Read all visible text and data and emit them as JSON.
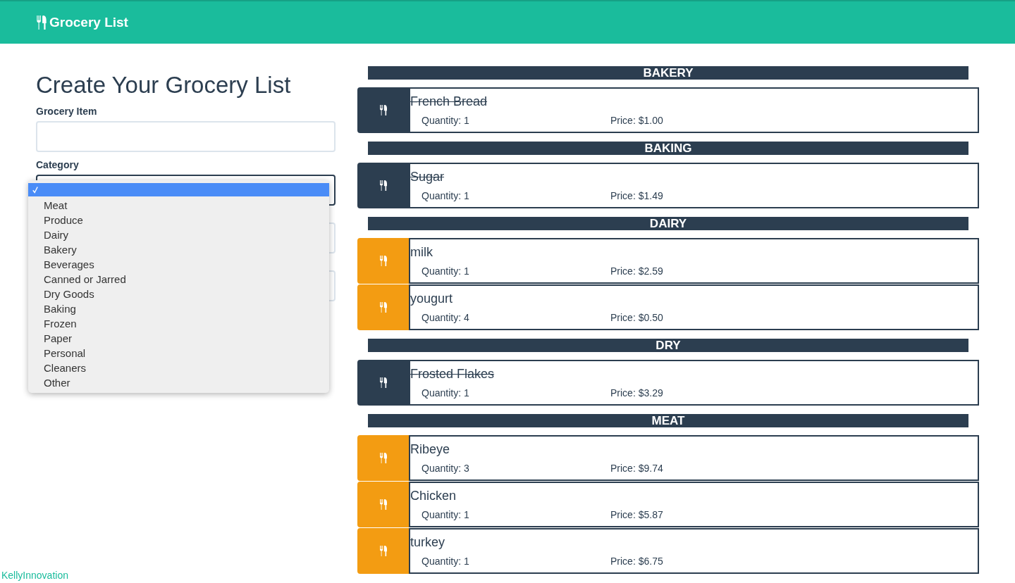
{
  "navbar": {
    "brand": "Grocery List"
  },
  "form": {
    "title": "Create Your Grocery List",
    "fields": [
      {
        "label": "Grocery Item",
        "kind": "text"
      },
      {
        "label": "Category",
        "kind": "select"
      },
      {
        "kind": "text"
      },
      {
        "kind": "text"
      }
    ],
    "dropdown": {
      "options": [
        {
          "selected": true
        },
        {
          "label": "Meat",
          "selected": false
        },
        {
          "label": "Produce",
          "selected": false
        },
        {
          "label": "Dairy",
          "selected": false
        },
        {
          "label": "Bakery",
          "selected": false
        },
        {
          "label": "Beverages",
          "selected": false
        },
        {
          "label": "Canned or Jarred",
          "selected": false
        },
        {
          "label": "Dry Goods",
          "selected": false
        },
        {
          "label": "Baking",
          "selected": false
        },
        {
          "label": "Frozen",
          "selected": false
        },
        {
          "label": "Paper",
          "selected": false
        },
        {
          "label": "Personal",
          "selected": false
        },
        {
          "label": "Cleaners",
          "selected": false
        },
        {
          "label": "Other",
          "selected": false
        }
      ]
    }
  },
  "groups": [
    {
      "category": "BAKERY",
      "items": [
        {
          "name": "French Bread",
          "quantity": "Quantity: 1",
          "price": "Price: $1.00",
          "checked": true
        }
      ]
    },
    {
      "category": "BAKING",
      "items": [
        {
          "name": "Sugar",
          "quantity": "Quantity: 1",
          "price": "Price: $1.49",
          "checked": true
        }
      ]
    },
    {
      "category": "DAIRY",
      "items": [
        {
          "name": "milk",
          "quantity": "Quantity: 1",
          "price": "Price: $2.59",
          "checked": false
        },
        {
          "name": "yougurt",
          "quantity": "Quantity: 4",
          "price": "Price: $0.50",
          "checked": false
        }
      ]
    },
    {
      "category": "DRY",
      "items": [
        {
          "name": "Frosted Flakes",
          "quantity": "Quantity: 1",
          "price": "Price: $3.29",
          "checked": true
        }
      ]
    },
    {
      "category": "MEAT",
      "items": [
        {
          "name": "Ribeye",
          "quantity": "Quantity: 3",
          "price": "Price: $9.74",
          "checked": false
        },
        {
          "name": "Chicken",
          "quantity": "Quantity: 1",
          "price": "Price: $5.87",
          "checked": false
        },
        {
          "name": "turkey",
          "quantity": "Quantity: 1",
          "price": "Price: $6.75",
          "checked": false
        }
      ]
    }
  ],
  "footer": {
    "credit": "KellyInnovation"
  }
}
